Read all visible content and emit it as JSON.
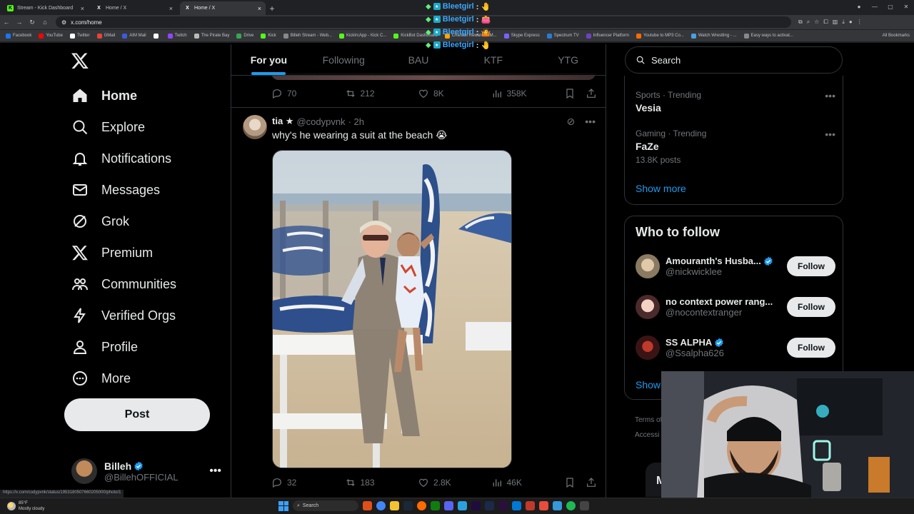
{
  "browser": {
    "tabs": [
      {
        "title": "Stream - Kick Dashboard",
        "active": false,
        "fav": "K",
        "color": "#53fc18"
      },
      {
        "title": "Home / X",
        "active": false,
        "fav": "X",
        "color": "#ffffff"
      },
      {
        "title": "Home / X",
        "active": true,
        "fav": "X",
        "color": "#ffffff"
      }
    ],
    "url": "x.com/home",
    "bookmarks": [
      {
        "label": "Facebook",
        "color": "#1877f2"
      },
      {
        "label": "YouTube",
        "color": "#ff0000"
      },
      {
        "label": "Twitter",
        "color": "#ffffff"
      },
      {
        "label": "GMail",
        "color": "#ea4335"
      },
      {
        "label": "AIM Mail",
        "color": "#3b5bdb"
      },
      {
        "label": "",
        "color": "#ffffff"
      },
      {
        "label": "Twitch",
        "color": "#9146ff"
      },
      {
        "label": "The Pirate Bay",
        "color": "#bbbbbb"
      },
      {
        "label": "Drive",
        "color": "#34a853"
      },
      {
        "label": "Kick",
        "color": "#53fc18"
      },
      {
        "label": "Billeh Stream - Web...",
        "color": "#888888"
      },
      {
        "label": "KickIrcApp - Kick C...",
        "color": "#53fc18"
      },
      {
        "label": "KickBot Dashboard",
        "color": "#53fc18"
      },
      {
        "label": "Channel Rewards - M...",
        "color": "#ffa500"
      },
      {
        "label": "Skype Express",
        "color": "#7b61ff"
      },
      {
        "label": "Spectrum TV",
        "color": "#2a7bd4"
      },
      {
        "label": "Influencer Platform",
        "color": "#6f42c1"
      },
      {
        "label": "Youtube to MP3 Co...",
        "color": "#ff6b00"
      },
      {
        "label": "Watch Wrestling - ...",
        "color": "#4aa0e0"
      },
      {
        "label": "Easy ways to activat...",
        "color": "#888888"
      }
    ],
    "all_bookmarks": "All Bookmarks"
  },
  "chat_overlay": [
    {
      "user": "Bleetgirl",
      "msg": ": 🤚"
    },
    {
      "user": "Bleetgirl",
      "msg": ": 👛"
    },
    {
      "user": "Bleetgirl",
      "msg": ": 🤷"
    },
    {
      "user": "Bleetgirl",
      "msg": ": 🤚"
    }
  ],
  "nav": {
    "items": [
      {
        "label": "Home",
        "icon": "home-icon"
      },
      {
        "label": "Explore",
        "icon": "search-icon"
      },
      {
        "label": "Notifications",
        "icon": "bell-icon"
      },
      {
        "label": "Messages",
        "icon": "mail-icon"
      },
      {
        "label": "Grok",
        "icon": "grok-icon"
      },
      {
        "label": "Premium",
        "icon": "x-icon"
      },
      {
        "label": "Communities",
        "icon": "people-icon"
      },
      {
        "label": "Verified Orgs",
        "icon": "bolt-icon"
      },
      {
        "label": "Profile",
        "icon": "person-icon"
      },
      {
        "label": "More",
        "icon": "more-circle-icon"
      }
    ],
    "post_label": "Post",
    "account": {
      "name": "Billeh",
      "handle": "@BillehOFFICIAL"
    }
  },
  "feed": {
    "tabs": [
      "For you",
      "Following",
      "BAU",
      "KTF",
      "YTG"
    ],
    "prev_tweet_stats": {
      "replies": "70",
      "reposts": "212",
      "likes": "8K",
      "views": "358K"
    },
    "tweet": {
      "name": "tia ★",
      "handle": "@codypvnk",
      "time": "· 2h",
      "text": "why's he wearing a suit at the beach 😭",
      "stats": {
        "replies": "32",
        "reposts": "183",
        "likes": "2.8K",
        "views": "46K"
      }
    }
  },
  "right": {
    "search_placeholder": "Search",
    "trends": [
      {
        "meta": "Sports · Trending",
        "topic": "Vesia",
        "count": ""
      },
      {
        "meta": "Gaming · Trending",
        "topic": "FaZe",
        "count": "13.8K posts"
      }
    ],
    "show_more": "Show more",
    "who_to_follow": "Who to follow",
    "follow_suggestions": [
      {
        "name": "Amouranth's Husba...",
        "handle": "@nickwicklee",
        "verified": true
      },
      {
        "name": "no context power rang...",
        "handle": "@nocontextranger",
        "verified": false
      },
      {
        "name": "SS ALPHA",
        "handle": "@Ssalpha626",
        "verified": true
      }
    ],
    "follow_label": "Follow",
    "show_partial": "Show",
    "footer": [
      "Terms of",
      "Accessi"
    ],
    "messages_peek": "M"
  },
  "status_url": "https://x.com/codypvnk/status/1953180507660205000/photo/1",
  "taskbar": {
    "temp": "85°F",
    "weather": "Mostly cloudy",
    "search": "Search"
  }
}
